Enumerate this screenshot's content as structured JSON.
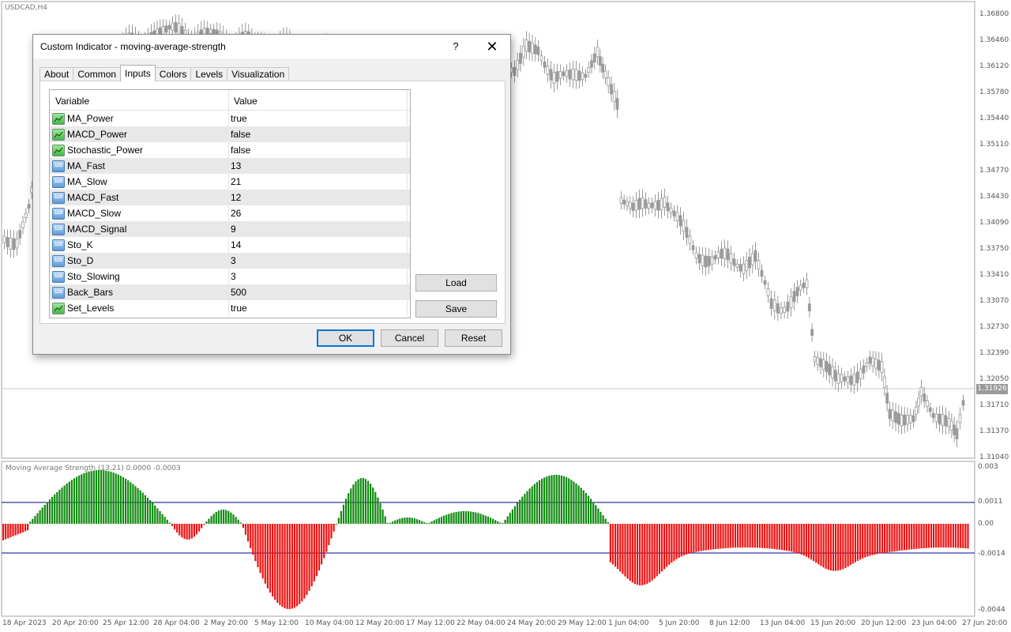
{
  "chart": {
    "symbol": "USDCAD,H4",
    "current_price": "1.31926",
    "price_scale": [
      "1.36800",
      "1.36460",
      "1.36120",
      "1.35780",
      "1.35440",
      "1.35110",
      "1.34770",
      "1.34430",
      "1.34090",
      "1.33750",
      "1.33410",
      "1.33070",
      "1.32730",
      "1.32390",
      "1.32050",
      "1.31710",
      "1.31370",
      "1.31040"
    ],
    "time_axis": [
      "18 Apr 2023",
      "20 Apr 20:00",
      "25 Apr 12:00",
      "28 Apr 04:00",
      "2 May 20:00",
      "5 May 12:00",
      "10 May 04:00",
      "12 May 20:00",
      "17 May 12:00",
      "22 May 04:00",
      "24 May 20:00",
      "29 May 12:00",
      "1 Jun 04:00",
      "5 Jun 20:00",
      "8 Jun 12:00",
      "13 Jun 04:00",
      "15 Jun 20:00",
      "20 Jun 12:00",
      "23 Jun 04:00",
      "27 Jun 20:00"
    ],
    "indicator": {
      "label": "Moving Average Strength (13,21) 0.0000 -0.0003",
      "scale": [
        "0.003",
        "0.0011",
        "0.00",
        "-0.0014",
        "-0.0044"
      ],
      "colors": {
        "positive": "#108a10",
        "negative": "#ee1111",
        "levels": "#00008b"
      }
    }
  },
  "dialog": {
    "title": "Custom Indicator - moving-average-strength",
    "help": "?",
    "close": "✕",
    "tabs": [
      "About",
      "Common",
      "Inputs",
      "Colors",
      "Levels",
      "Visualization"
    ],
    "active_tab": "Inputs",
    "grid": {
      "headers": {
        "variable": "Variable",
        "value": "Value"
      },
      "rows": [
        {
          "name": "MA_Power",
          "value": "true",
          "type": "bool"
        },
        {
          "name": "MACD_Power",
          "value": "false",
          "type": "bool"
        },
        {
          "name": "Stochastic_Power",
          "value": "false",
          "type": "bool"
        },
        {
          "name": "MA_Fast",
          "value": "13",
          "type": "int"
        },
        {
          "name": "MA_Slow",
          "value": "21",
          "type": "int"
        },
        {
          "name": "MACD_Fast",
          "value": "12",
          "type": "int"
        },
        {
          "name": "MACD_Slow",
          "value": "26",
          "type": "int"
        },
        {
          "name": "MACD_Signal",
          "value": "9",
          "type": "int"
        },
        {
          "name": "Sto_K",
          "value": "14",
          "type": "int"
        },
        {
          "name": "Sto_D",
          "value": "3",
          "type": "int"
        },
        {
          "name": "Sto_Slowing",
          "value": "3",
          "type": "int"
        },
        {
          "name": "Back_Bars",
          "value": "500",
          "type": "int"
        },
        {
          "name": "Set_Levels",
          "value": "true",
          "type": "bool"
        }
      ],
      "int_icon_text": "123"
    },
    "buttons": {
      "load": "Load",
      "save": "Save",
      "ok": "OK",
      "cancel": "Cancel",
      "reset": "Reset"
    }
  }
}
